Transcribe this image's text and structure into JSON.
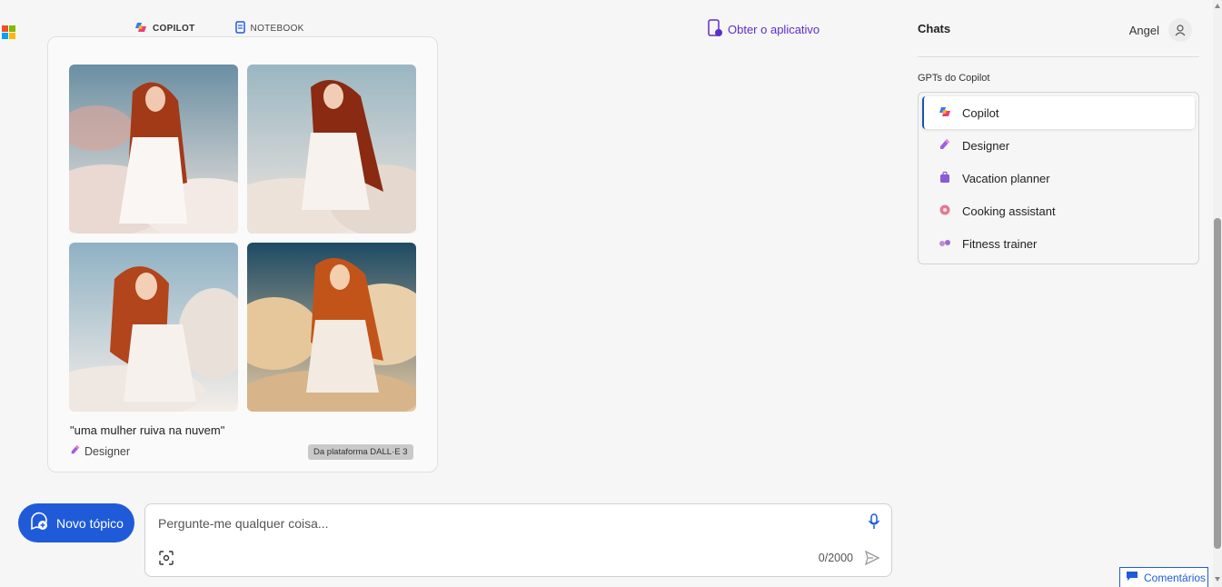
{
  "header": {
    "tabs": [
      {
        "label": "COPILOT",
        "icon": "copilot-icon",
        "active": true
      },
      {
        "label": "NOTEBOOK",
        "icon": "notebook-icon",
        "active": false
      }
    ],
    "get_app_label": "Obter o aplicativo"
  },
  "sidebar": {
    "chats_title": "Chats",
    "user_name": "Angel",
    "gpts_title": "GPTs do Copilot",
    "gpts": [
      {
        "label": "Copilot",
        "icon": "copilot-icon",
        "active": true
      },
      {
        "label": "Designer",
        "icon": "designer-icon",
        "active": false
      },
      {
        "label": "Vacation planner",
        "icon": "suitcase-icon",
        "active": false
      },
      {
        "label": "Cooking assistant",
        "icon": "donut-icon",
        "active": false
      },
      {
        "label": "Fitness trainer",
        "icon": "dumbbell-icon",
        "active": false
      }
    ]
  },
  "result_card": {
    "images": [
      {
        "name": "generated-image-1"
      },
      {
        "name": "generated-image-2"
      },
      {
        "name": "generated-image-3"
      },
      {
        "name": "generated-image-4"
      }
    ],
    "caption": "\"uma mulher ruiva na nuvem\"",
    "designer_label": "Designer",
    "dalle_badge": "Da plataforma DALL·E 3"
  },
  "composer": {
    "new_topic_label": "Novo tópico",
    "placeholder": "Pergunte-me qualquer coisa...",
    "counter": "0/2000"
  },
  "feedback_label": "Comentários",
  "colors": {
    "accent": "#1f5bd9",
    "get_app": "#5b2fc9",
    "background": "#f6f6f6"
  }
}
